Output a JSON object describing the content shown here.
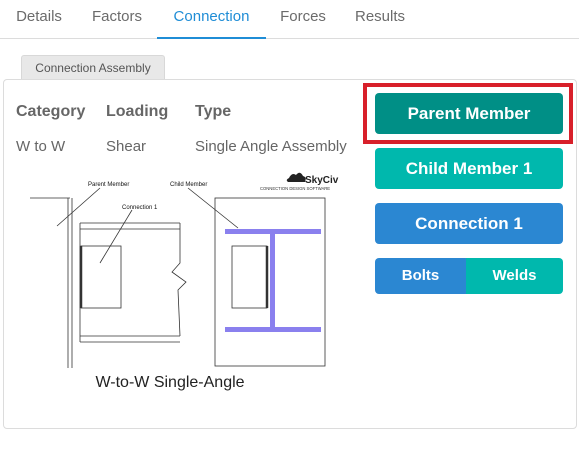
{
  "tabs": [
    "Details",
    "Factors",
    "Connection",
    "Forces",
    "Results"
  ],
  "active_tab": "Connection",
  "sub_tab": "Connection Assembly",
  "info": {
    "category_label": "Category",
    "category_value": "W to W",
    "loading_label": "Loading",
    "loading_value": "Shear",
    "type_label": "Type",
    "type_value": "Single Angle Assembly"
  },
  "diagram": {
    "parent_label": "Parent Member",
    "child_label": "Child Member",
    "connection_label": "Connection 1",
    "logo_text": "SkyCiv",
    "logo_subtext": "CONNECTION DESIGN SOFTWARE",
    "caption": "W-to-W Single-Angle"
  },
  "buttons": {
    "parent_member": "Parent Member",
    "child_member": "Child Member 1",
    "connection": "Connection 1",
    "bolts": "Bolts",
    "welds": "Welds"
  },
  "colors": {
    "accent_blue": "#1f8dd6",
    "parent_btn": "#008f86",
    "child_btn": "#00b8ad",
    "connection_btn": "#2b87d2",
    "bolts_btn": "#2b87d2",
    "welds_btn": "#00b8ad",
    "highlight": "#d8202a",
    "member_purple": "#8a80ee"
  }
}
